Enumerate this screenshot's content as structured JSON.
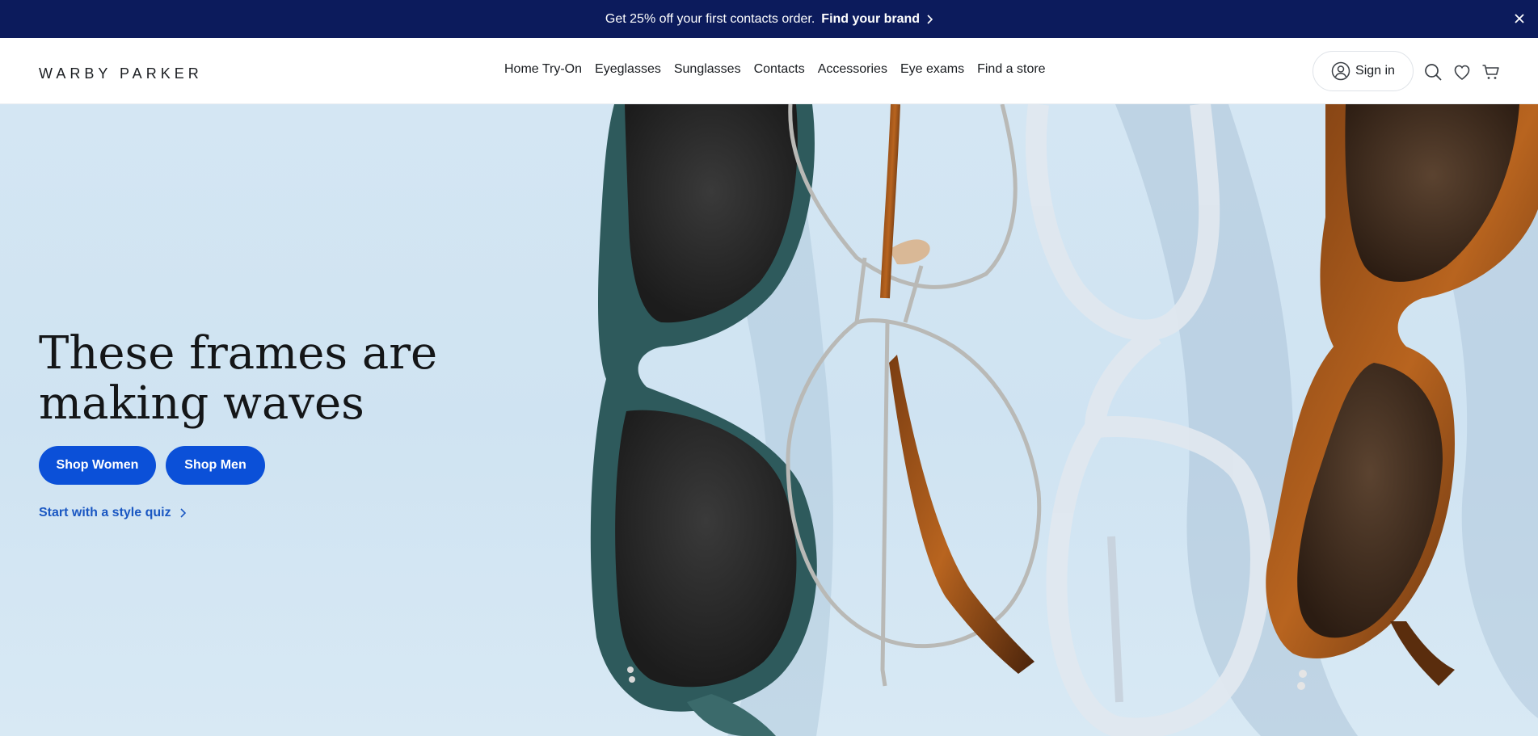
{
  "promo": {
    "message": "Get 25% off your first contacts order.",
    "link_label": "Find your brand",
    "bg_color": "#0c1b5c"
  },
  "header": {
    "logo": "WARBY PARKER",
    "nav": [
      {
        "label": "Home Try-On"
      },
      {
        "label": "Eyeglasses"
      },
      {
        "label": "Sunglasses"
      },
      {
        "label": "Contacts"
      },
      {
        "label": "Accessories"
      },
      {
        "label": "Eye exams"
      },
      {
        "label": "Find a store"
      }
    ],
    "sign_in": "Sign in",
    "icons": [
      "user-icon",
      "search-icon",
      "heart-icon",
      "cart-icon"
    ]
  },
  "hero": {
    "headline": "These frames are making waves",
    "shop_women": "Shop Women",
    "shop_men": "Shop Men",
    "quiz_link": "Start with a style quiz",
    "button_color": "#0b50d8",
    "link_color": "#1a57c2"
  }
}
